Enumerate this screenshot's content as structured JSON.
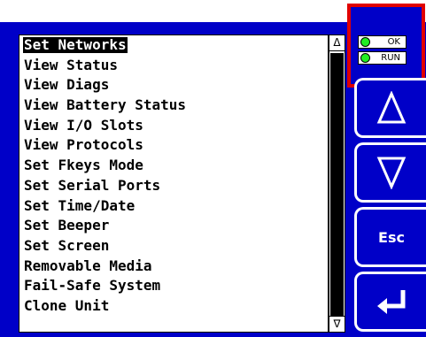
{
  "menu": {
    "items": [
      {
        "label": "Set Networks",
        "selected": true
      },
      {
        "label": "View Status"
      },
      {
        "label": "View Diags"
      },
      {
        "label": "View Battery Status"
      },
      {
        "label": "View I/O Slots"
      },
      {
        "label": "View Protocols"
      },
      {
        "label": "Set Fkeys Mode"
      },
      {
        "label": "Set Serial Ports"
      },
      {
        "label": "Set Time/Date"
      },
      {
        "label": "Set Beeper"
      },
      {
        "label": "Set Screen"
      },
      {
        "label": "Removable Media"
      },
      {
        "label": "Fail-Safe System"
      },
      {
        "label": "Clone Unit"
      }
    ]
  },
  "scrollbar": {
    "up_glyph": "Δ",
    "down_glyph": "∇"
  },
  "status": {
    "ok_label": "OK",
    "run_label": "RUN"
  },
  "fkeys": {
    "up_icon": "up-triangle-icon",
    "down_icon": "down-triangle-icon",
    "esc_label": "Esc",
    "enter_icon": "enter-arrow-icon"
  },
  "colors": {
    "panel_blue": "#0000c8",
    "highlight_red": "#e00000",
    "led_green": "#22ee22"
  }
}
